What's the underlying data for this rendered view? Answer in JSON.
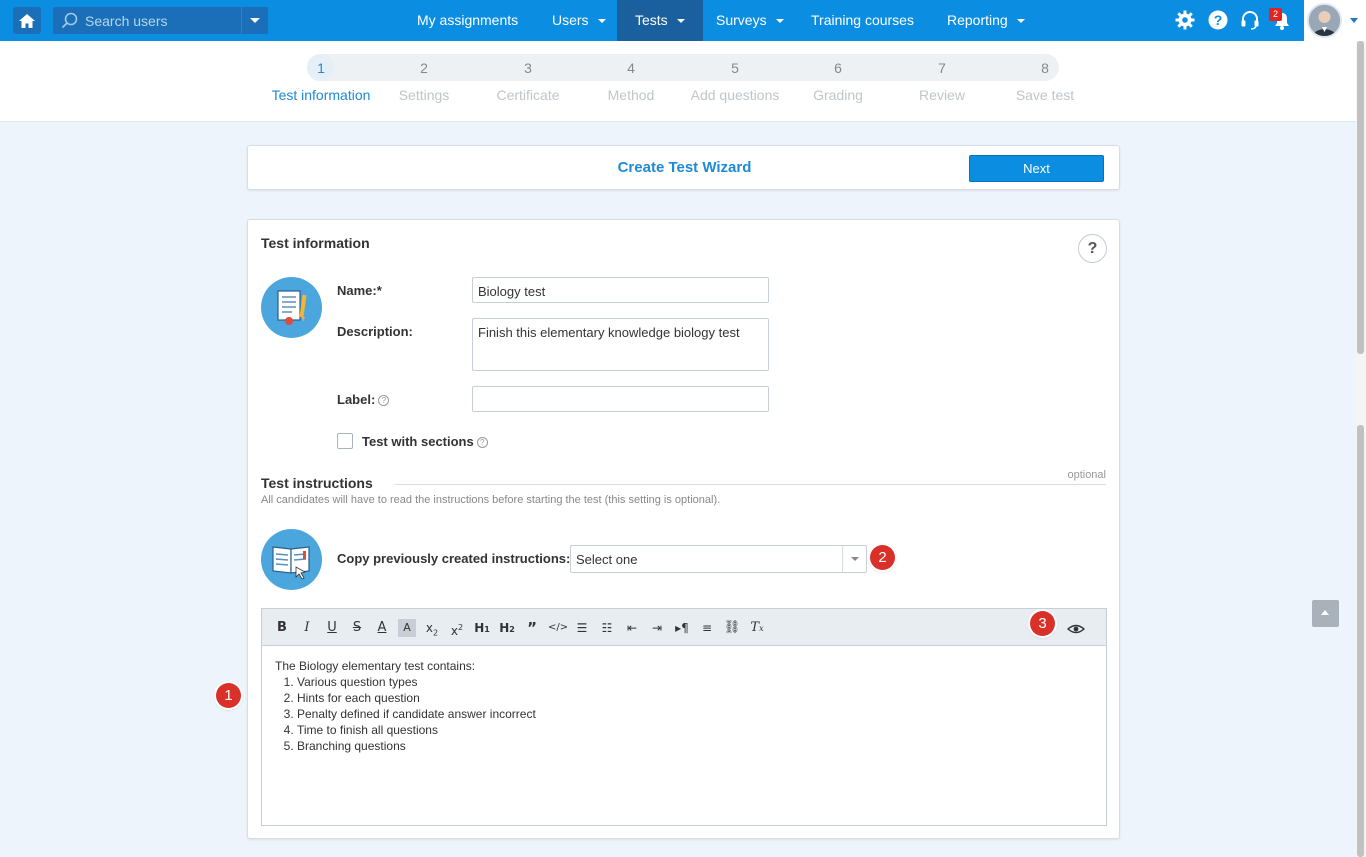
{
  "nav": {
    "search_placeholder": "Search users",
    "items": [
      {
        "label": "My assignments"
      },
      {
        "label": "Users"
      },
      {
        "label": "Tests"
      },
      {
        "label": "Surveys"
      },
      {
        "label": "Training courses"
      },
      {
        "label": "Reporting"
      }
    ],
    "notification_count": "2",
    "icons": [
      "home-icon",
      "search-icon",
      "gear-icon",
      "help-icon",
      "headset-icon",
      "bell-icon"
    ]
  },
  "stepper": {
    "steps": [
      {
        "num": "1",
        "label": "Test information"
      },
      {
        "num": "2",
        "label": "Settings"
      },
      {
        "num": "3",
        "label": "Certificate"
      },
      {
        "num": "4",
        "label": "Method"
      },
      {
        "num": "5",
        "label": "Add questions"
      },
      {
        "num": "6",
        "label": "Grading"
      },
      {
        "num": "7",
        "label": "Review"
      },
      {
        "num": "8",
        "label": "Save test"
      }
    ],
    "active_step": 1
  },
  "wizard": {
    "title": "Create Test Wizard",
    "next_label": "Next"
  },
  "test_info": {
    "title": "Test information",
    "help": "?",
    "name_label": "Name:*",
    "name_value": "Biology test",
    "description_label": "Description:",
    "description_value": "Finish this elementary knowledge biology test",
    "label_label": "Label:",
    "label_value": "",
    "sections_label": "Test with sections"
  },
  "instructions": {
    "title": "Test instructions",
    "optional": "optional",
    "note": "All candidates will have to read the instructions before starting the test (this setting is optional).",
    "copy_label": "Copy previously created instructions:",
    "select_value": "Select one",
    "editor_intro": "The Biology elementary test contains:",
    "editor_items": [
      "Various question types",
      "Hints for each question",
      "Penalty defined if candidate answer incorrect",
      "Time to finish all questions",
      "Branching questions"
    ]
  },
  "markers": [
    "1",
    "2",
    "3"
  ],
  "colors": {
    "primary": "#0b8ee2",
    "nav_active": "#1a5f9e",
    "marker": "#d9302a",
    "accent_text": "#1e8ad8"
  }
}
